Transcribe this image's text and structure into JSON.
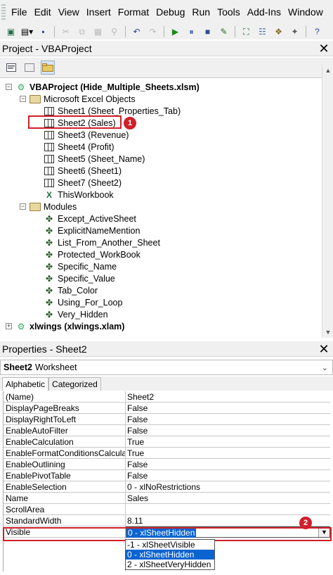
{
  "menu": [
    "File",
    "Edit",
    "View",
    "Insert",
    "Format",
    "Debug",
    "Run",
    "Tools",
    "Add-Ins",
    "Window"
  ],
  "toolbar_icons": [
    "excel-icon",
    "insert-userform-icon",
    "save-icon",
    "cut-icon",
    "copy-icon",
    "paste-icon",
    "find-icon",
    "undo-icon",
    "redo-icon",
    "run-icon",
    "break-icon",
    "reset-icon",
    "design-mode-icon",
    "project-explorer-icon",
    "properties-icon",
    "object-browser-icon",
    "toolbox-icon",
    "help-icon"
  ],
  "project_pane": {
    "title": "Project - VBAProject",
    "close": "✕"
  },
  "tree": {
    "root": "VBAProject (Hide_Multiple_Sheets.xlsm)",
    "excel_objects_folder": "Microsoft Excel Objects",
    "sheets": [
      "Sheet1 (Sheet_Properties_Tab)",
      "Sheet2 (Sales)",
      "Sheet3 (Revenue)",
      "Sheet4 (Profit)",
      "Sheet5 (Sheet_Name)",
      "Sheet6 (Sheet1)",
      "Sheet7 (Sheet2)"
    ],
    "workbook": "ThisWorkbook",
    "modules_folder": "Modules",
    "modules": [
      "Except_ActiveSheet",
      "ExplicitNameMention",
      "List_From_Another_Sheet",
      "Protected_WorkBook",
      "Specific_Name",
      "Specific_Value",
      "Tab_Color",
      "Using_For_Loop",
      "Very_Hidden"
    ],
    "other_project": "xlwings (xlwings.xlam)"
  },
  "callouts": {
    "first": "1",
    "second": "2"
  },
  "properties_pane": {
    "title": "Properties - Sheet2",
    "close": "✕",
    "object_name": "Sheet2",
    "object_type": "Worksheet",
    "tabs": [
      "Alphabetic",
      "Categorized"
    ],
    "rows": [
      {
        "name": "(Name)",
        "value": "Sheet2"
      },
      {
        "name": "DisplayPageBreaks",
        "value": "False"
      },
      {
        "name": "DisplayRightToLeft",
        "value": "False"
      },
      {
        "name": "EnableAutoFilter",
        "value": "False"
      },
      {
        "name": "EnableCalculation",
        "value": "True"
      },
      {
        "name": "EnableFormatConditionsCalculation",
        "value": "True"
      },
      {
        "name": "EnableOutlining",
        "value": "False"
      },
      {
        "name": "EnablePivotTable",
        "value": "False"
      },
      {
        "name": "EnableSelection",
        "value": "0 - xlNoRestrictions"
      },
      {
        "name": "Name",
        "value": "Sales"
      },
      {
        "name": "ScrollArea",
        "value": ""
      },
      {
        "name": "StandardWidth",
        "value": "8.11"
      },
      {
        "name": "Visible",
        "value": "0 - xlSheetHidden"
      }
    ],
    "visible_options": [
      "-1 - xlSheetVisible",
      "0 - xlSheetHidden",
      "2 - xlSheetVeryHidden"
    ],
    "visible_selected": "0 - xlSheetHidden"
  },
  "colors": {
    "callout": "#d0202a",
    "selection": "#0a64d0"
  }
}
